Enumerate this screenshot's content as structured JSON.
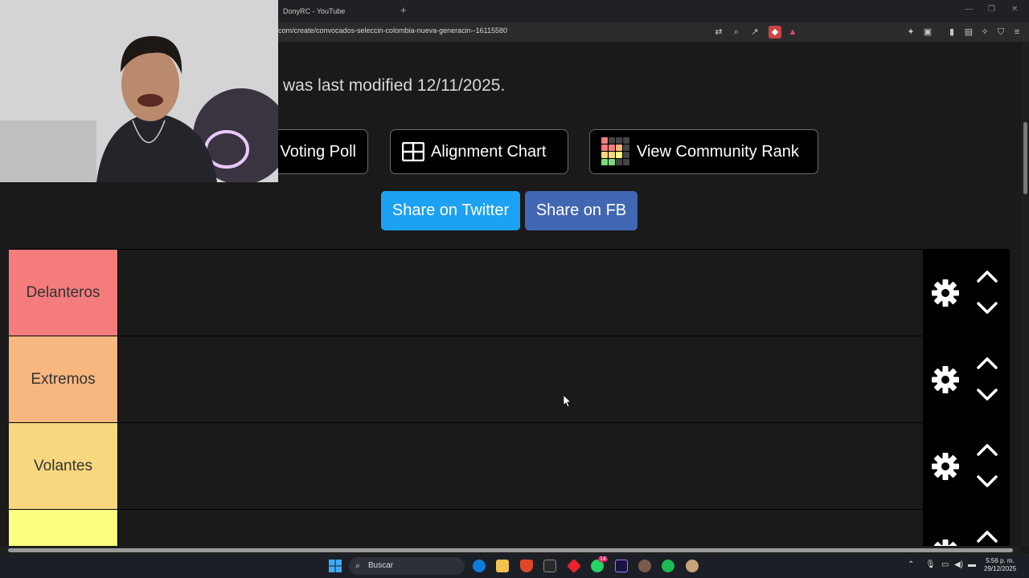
{
  "browser": {
    "tab_title": "DonyRC - YouTube",
    "new_tab": "+",
    "url": "com/create/convocados-seleccin-colombia-nueva-generacin--16115580",
    "window_controls": [
      "—",
      "❐",
      "✕"
    ]
  },
  "page": {
    "modified_text": "was last modified 12/11/2025.",
    "buttons": {
      "voting_poll": "Voting Poll",
      "alignment_chart": "Alignment Chart",
      "community_rank": "View Community Rank"
    },
    "share": {
      "twitter": "Share on Twitter",
      "fb": "Share on FB",
      "twitter_color": "#1da1f2",
      "fb_color": "#4267b2"
    },
    "tiers": [
      {
        "label": "Delanteros",
        "color": "#f47c7c"
      },
      {
        "label": "Extremos",
        "color": "#f7b77f"
      },
      {
        "label": "Volantes",
        "color": "#f7d87f"
      },
      {
        "label": "",
        "color": "#fdfd7f"
      }
    ]
  },
  "taskbar": {
    "search_placeholder": "Buscar",
    "whatsapp_badge": "14",
    "clock_time": "5:56 p. m.",
    "clock_date": "29/12/2025"
  }
}
